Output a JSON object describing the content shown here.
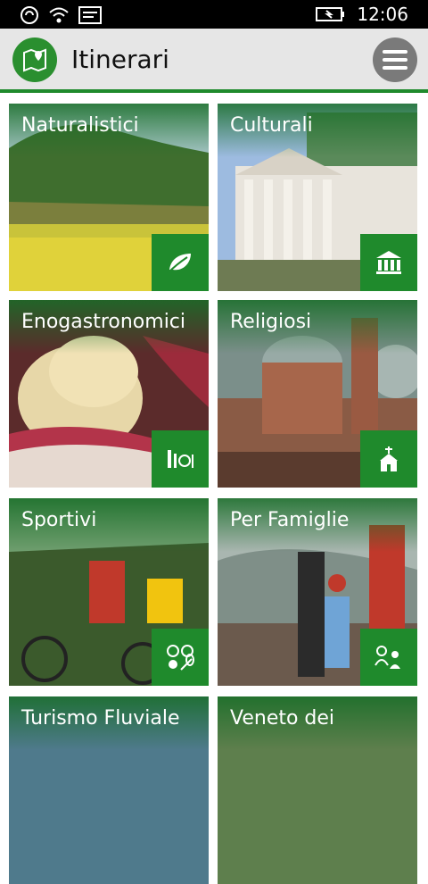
{
  "status_bar": {
    "time": "12:06",
    "icons": [
      "nfc-icon",
      "wifi-icon",
      "message-icon",
      "battery-charging-icon"
    ]
  },
  "app_bar": {
    "title": "Itinerari",
    "logo_icon": "map-pin-icon",
    "menu_icon": "hamburger-menu-icon"
  },
  "tiles": [
    {
      "label": "Naturalistici",
      "icon": "leaf-icon"
    },
    {
      "label": "Culturali",
      "icon": "museum-icon"
    },
    {
      "label": "Enogastronomici",
      "icon": "wine-dining-icon"
    },
    {
      "label": "Religiosi",
      "icon": "church-icon"
    },
    {
      "label": "Sportivi",
      "icon": "sports-balls-icon"
    },
    {
      "label": "Per Famiglie",
      "icon": "family-icon"
    },
    {
      "label": "Turismo Fluviale",
      "icon": "boat-icon"
    },
    {
      "label": "Veneto dei",
      "icon": "villa-icon"
    }
  ],
  "colors": {
    "accent": "#1f8a2c",
    "appbar_bg": "#e6e6e6",
    "statusbar_bg": "#000000"
  }
}
